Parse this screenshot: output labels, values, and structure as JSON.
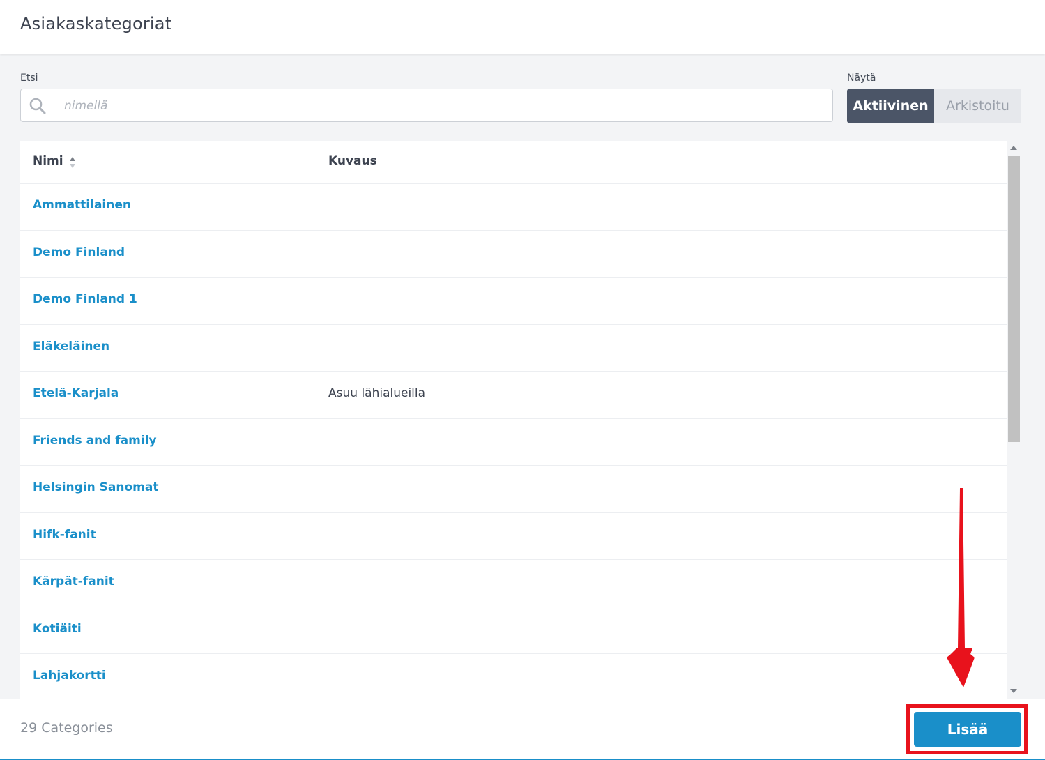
{
  "header": {
    "title": "Asiakaskategoriat"
  },
  "search": {
    "label": "Etsi",
    "placeholder": "nimellä",
    "value": "",
    "icon": "search-icon"
  },
  "filter": {
    "label": "Näytä",
    "options": [
      {
        "label": "Aktiivinen",
        "active": true
      },
      {
        "label": "Arkistoitu",
        "active": false
      }
    ]
  },
  "table": {
    "columns": [
      {
        "label": "Nimi",
        "sortable": true
      },
      {
        "label": "Kuvaus"
      }
    ],
    "rows": [
      {
        "name": "Ammattilainen",
        "description": ""
      },
      {
        "name": "Demo Finland",
        "description": ""
      },
      {
        "name": "Demo Finland 1",
        "description": ""
      },
      {
        "name": "Eläkeläinen",
        "description": ""
      },
      {
        "name": "Etelä-Karjala",
        "description": "Asuu lähialueilla"
      },
      {
        "name": "Friends and family",
        "description": ""
      },
      {
        "name": "Helsingin Sanomat",
        "description": ""
      },
      {
        "name": "Hifk-fanit",
        "description": ""
      },
      {
        "name": "Kärpät-fanit",
        "description": ""
      },
      {
        "name": "Kotiäiti",
        "description": ""
      },
      {
        "name": "Lahjakortti",
        "description": ""
      }
    ]
  },
  "footer": {
    "count_text": "29 Categories",
    "add_label": "Lisää"
  },
  "colors": {
    "accent": "#1a8fc9",
    "toggle_active": "#4b5567",
    "highlight": "#e8121c"
  }
}
